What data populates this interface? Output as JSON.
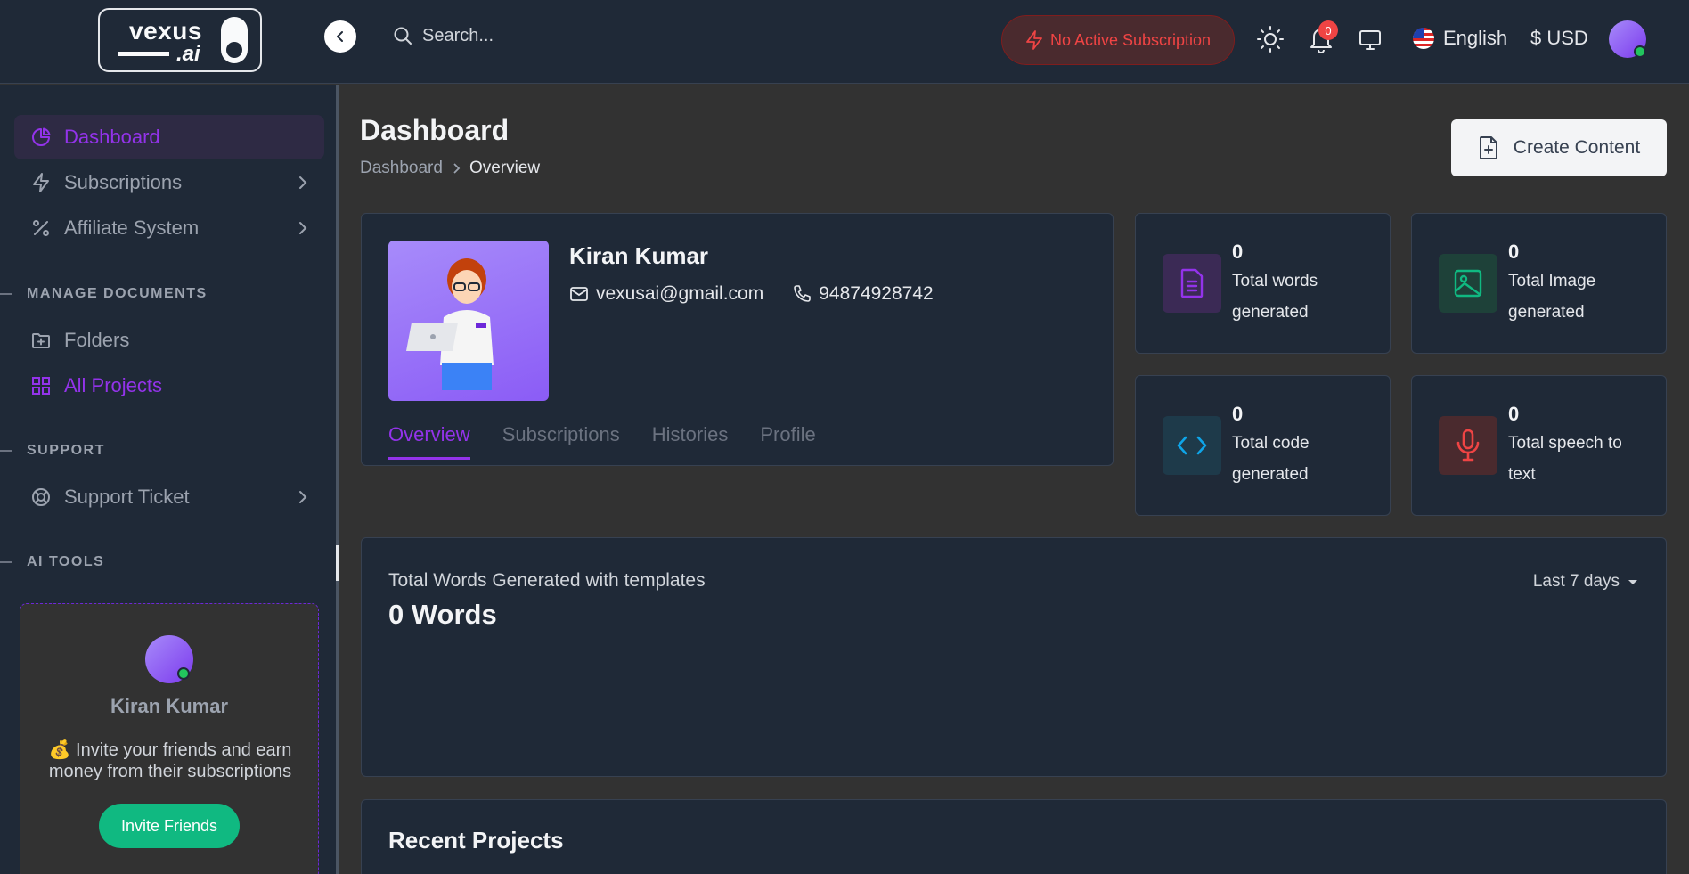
{
  "header": {
    "logo_text_top": "vexus",
    "logo_text_bottom": ".ai",
    "search_placeholder": "Search...",
    "subscription_status": "No Active Subscription",
    "notification_count": "0",
    "language": "English",
    "currency": "$ USD"
  },
  "sidebar": {
    "items": [
      {
        "label": "Dashboard"
      },
      {
        "label": "Subscriptions"
      },
      {
        "label": "Affiliate System"
      },
      {
        "label": "Folders"
      },
      {
        "label": "All Projects"
      },
      {
        "label": "Support Ticket"
      }
    ],
    "sections": {
      "manage_documents": "MANAGE DOCUMENTS",
      "support": "SUPPORT",
      "ai_tools": "AI TOOLS"
    },
    "invite_card": {
      "name": "Kiran Kumar",
      "text": "💰 Invite your friends and earn money from their subscriptions",
      "button": "Invite Friends"
    }
  },
  "main": {
    "title": "Dashboard",
    "breadcrumb": [
      "Dashboard",
      "Overview"
    ],
    "create_button": "Create Content",
    "profile": {
      "name": "Kiran Kumar",
      "email": "vexusai@gmail.com",
      "phone": "94874928742",
      "tabs": [
        "Overview",
        "Subscriptions",
        "Histories",
        "Profile"
      ]
    },
    "stats": [
      {
        "value": "0",
        "label": "Total words generated",
        "icon": "document-icon",
        "color": "#9333ea"
      },
      {
        "value": "0",
        "label": "Total Image generated",
        "icon": "image-icon",
        "color": "#10b981"
      },
      {
        "value": "0",
        "label": "Total code generated",
        "icon": "code-icon",
        "color": "#0ea5e9"
      },
      {
        "value": "0",
        "label": "Total speech to text",
        "icon": "microphone-icon",
        "color": "#ef4444"
      }
    ],
    "words_chart": {
      "title": "Total Words Generated with templates",
      "value": "0 Words",
      "range": "Last 7 days"
    },
    "recent_projects": {
      "title": "Recent Projects"
    }
  },
  "colors": {
    "accent": "#9333ea",
    "success": "#10b981",
    "danger": "#ef4444"
  }
}
